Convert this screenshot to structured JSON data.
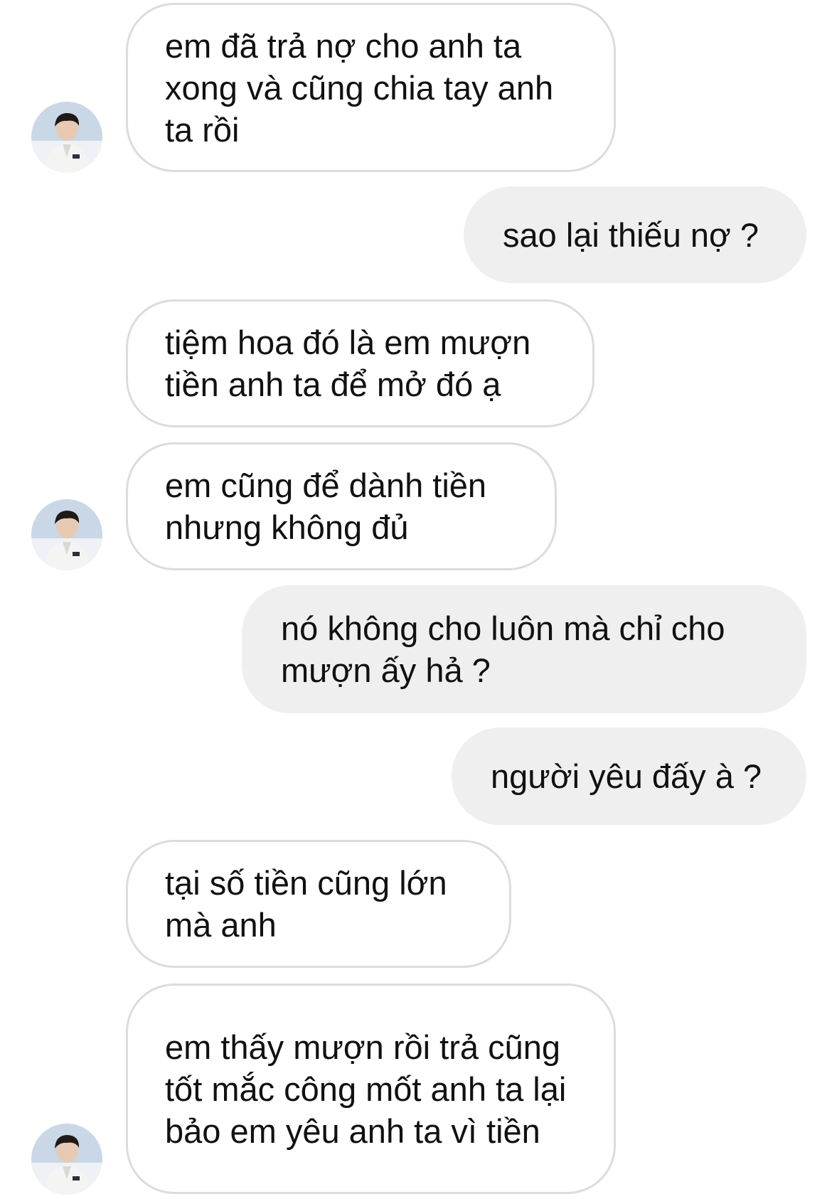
{
  "messages": [
    {
      "id": "m1",
      "side": "incoming",
      "text": "em đã trả nợ cho anh ta xong và cũng chia tay anh ta rồi"
    },
    {
      "id": "m2",
      "side": "outgoing",
      "text": "sao lại thiếu nợ ?"
    },
    {
      "id": "m3",
      "side": "incoming",
      "text": "tiệm hoa đó là em mượn tiền anh ta để mở đó ạ"
    },
    {
      "id": "m4",
      "side": "incoming",
      "text": "em cũng để dành tiền nhưng không đủ"
    },
    {
      "id": "m5",
      "side": "outgoing",
      "text": "nó không cho luôn mà chỉ cho mượn ấy hả ?"
    },
    {
      "id": "m6",
      "side": "outgoing",
      "text": "người yêu đấy à ?"
    },
    {
      "id": "m7",
      "side": "incoming",
      "text": "tại số tiền cũng lớn mà anh"
    },
    {
      "id": "m8",
      "side": "incoming",
      "text": "em thấy mượn rồi trả cũng tốt mắc công mốt anh ta lại bảo em yêu anh ta vì tiền"
    }
  ],
  "colors": {
    "incoming_bubble_bg": "#ffffff",
    "incoming_bubble_border": "#dcdcdc",
    "outgoing_bubble_bg": "#efefef",
    "text": "#111111"
  },
  "avatar": {
    "icon": "contact-avatar-icon"
  }
}
